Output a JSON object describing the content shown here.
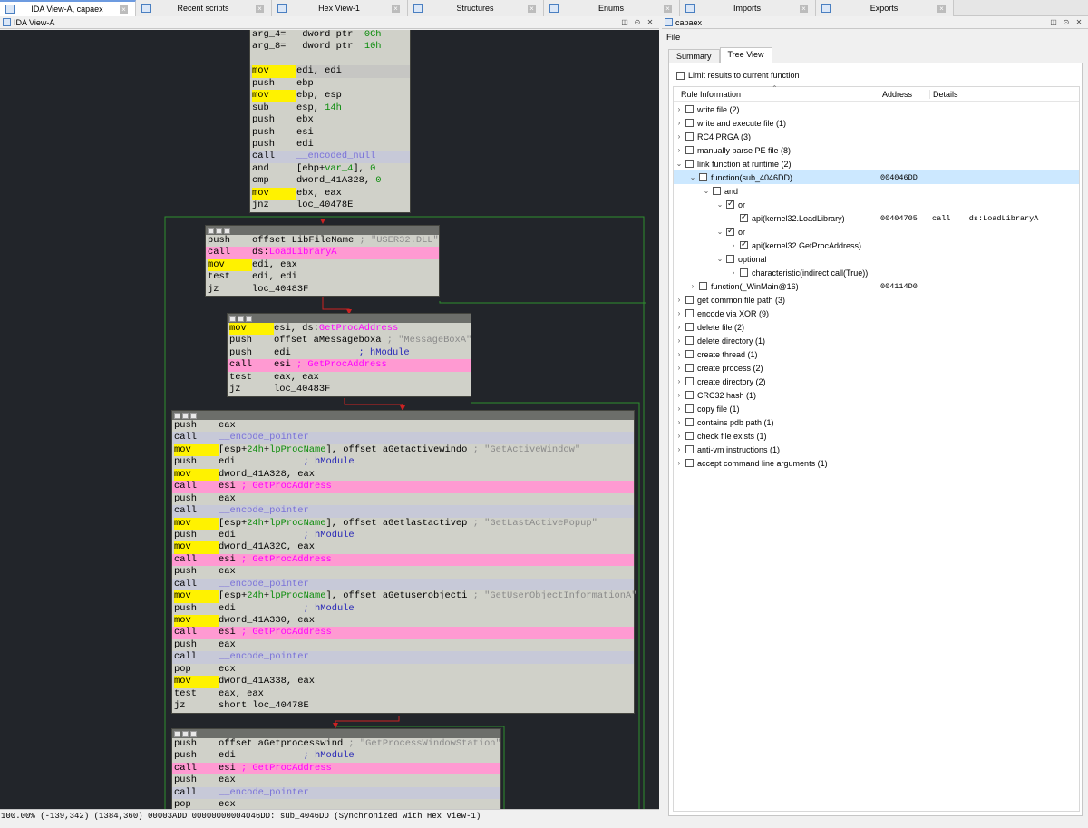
{
  "tabs": [
    {
      "label": "IDA View-A, capaex",
      "active": true
    },
    {
      "label": "Recent scripts"
    },
    {
      "label": "Hex View-1"
    },
    {
      "label": "Structures"
    },
    {
      "label": "Enums"
    },
    {
      "label": "Imports"
    },
    {
      "label": "Exports"
    }
  ],
  "ida": {
    "title": "IDA View-A",
    "status": "100.00% (-139,342) (1384,360) 00003ADD 00000000004046DD: sub_4046DD (Synchronized with Hex View-1)"
  },
  "capa": {
    "title": "capaex",
    "menu_file": "File",
    "tab_summary": "Summary",
    "tab_tree": "Tree View",
    "limit_label": "Limit results to current function",
    "col_rule": "Rule Information",
    "col_address": "Address",
    "col_details": "Details",
    "rows": [
      {
        "label": "write file (2)",
        "indent": 0,
        "arrow": "›",
        "cb": false
      },
      {
        "label": "write and execute file (1)",
        "indent": 0,
        "arrow": "›",
        "cb": false
      },
      {
        "label": "RC4 PRGA (3)",
        "indent": 0,
        "arrow": "›",
        "cb": false
      },
      {
        "label": "manually parse PE file (8)",
        "indent": 0,
        "arrow": "›",
        "cb": false
      },
      {
        "label": "link function at runtime (2)",
        "indent": 0,
        "arrow": "⌄",
        "cb": false
      },
      {
        "label": "function(sub_4046DD)",
        "indent": 1,
        "arrow": "⌄",
        "cb": false,
        "address": "004046DD",
        "selected": true
      },
      {
        "label": "and",
        "indent": 2,
        "arrow": "⌄",
        "cb": false
      },
      {
        "label": "or",
        "indent": 3,
        "arrow": "⌄",
        "cb": true
      },
      {
        "label": "api(kernel32.LoadLibrary)",
        "indent": 4,
        "arrow": "",
        "cb": true,
        "address": "00404705",
        "details": "call    ds:LoadLibraryA"
      },
      {
        "label": "or",
        "indent": 3,
        "arrow": "⌄",
        "cb": true
      },
      {
        "label": "api(kernel32.GetProcAddress)",
        "indent": 4,
        "arrow": "›",
        "cb": true
      },
      {
        "label": "optional",
        "indent": 3,
        "arrow": "⌄",
        "cb": false
      },
      {
        "label": "characteristic(indirect call(True))",
        "indent": 4,
        "arrow": "›",
        "cb": false
      },
      {
        "label": "function(_WinMain@16)",
        "indent": 1,
        "arrow": "›",
        "cb": false,
        "address": "004114D0"
      },
      {
        "label": "get common file path (3)",
        "indent": 0,
        "arrow": "›",
        "cb": false
      },
      {
        "label": "encode via XOR (9)",
        "indent": 0,
        "arrow": "›",
        "cb": false
      },
      {
        "label": "delete file (2)",
        "indent": 0,
        "arrow": "›",
        "cb": false
      },
      {
        "label": "delete directory (1)",
        "indent": 0,
        "arrow": "›",
        "cb": false
      },
      {
        "label": "create thread (1)",
        "indent": 0,
        "arrow": "›",
        "cb": false
      },
      {
        "label": "create process (2)",
        "indent": 0,
        "arrow": "›",
        "cb": false
      },
      {
        "label": "create directory (2)",
        "indent": 0,
        "arrow": "›",
        "cb": false
      },
      {
        "label": "CRC32 hash (1)",
        "indent": 0,
        "arrow": "›",
        "cb": false
      },
      {
        "label": "copy file (1)",
        "indent": 0,
        "arrow": "›",
        "cb": false
      },
      {
        "label": "contains pdb path (1)",
        "indent": 0,
        "arrow": "›",
        "cb": false
      },
      {
        "label": "check file exists (1)",
        "indent": 0,
        "arrow": "›",
        "cb": false
      },
      {
        "label": "anti-vm instructions (1)",
        "indent": 0,
        "arrow": "›",
        "cb": false
      },
      {
        "label": "accept command line arguments (1)",
        "indent": 0,
        "arrow": "›",
        "cb": false
      }
    ]
  },
  "graph": {
    "blocks": [
      {
        "header": false,
        "lines": [
          {
            "m": "arg_4=",
            "o": [
              [
                "",
                " dword ptr  "
              ],
              [
                "hx",
                "0Ch"
              ]
            ]
          },
          {
            "m": "arg_8=",
            "o": [
              [
                "",
                " dword ptr  "
              ],
              [
                "hx",
                "10h"
              ]
            ]
          },
          {
            "m": "",
            "o": []
          },
          {
            "m": "mov",
            "y": true,
            "hl": "line",
            "o": [
              [
                "",
                "edi, edi"
              ]
            ]
          },
          {
            "m": "push",
            "o": [
              [
                "",
                "ebp"
              ]
            ]
          },
          {
            "m": "mov",
            "y": true,
            "o": [
              [
                "",
                "ebp, esp"
              ]
            ]
          },
          {
            "m": "sub",
            "o": [
              [
                "",
                "esp, "
              ],
              [
                "hx",
                "14h"
              ]
            ]
          },
          {
            "m": "push",
            "o": [
              [
                "",
                "ebx"
              ]
            ]
          },
          {
            "m": "push",
            "o": [
              [
                "",
                "esi"
              ]
            ]
          },
          {
            "m": "push",
            "o": [
              [
                "",
                "edi"
              ]
            ]
          },
          {
            "m": "call",
            "hl": "grey",
            "o": [
              [
                "enc",
                "__encoded_null"
              ]
            ]
          },
          {
            "m": "and",
            "o": [
              [
                "",
                "[ebp+"
              ],
              [
                "lv",
                "var_4"
              ],
              [
                "",
                "], "
              ],
              [
                "hx",
                "0"
              ]
            ]
          },
          {
            "m": "cmp",
            "o": [
              [
                "",
                "dword_41A328, "
              ],
              [
                "hx",
                "0"
              ]
            ]
          },
          {
            "m": "mov",
            "y": true,
            "o": [
              [
                "",
                "ebx, eax"
              ]
            ]
          },
          {
            "m": "jnz",
            "o": [
              [
                "",
                "loc_40478E"
              ]
            ]
          }
        ]
      },
      {
        "header": true,
        "lines": [
          {
            "m": "push",
            "o": [
              [
                "",
                "offset LibFileName "
              ],
              [
                "cm",
                "; \"USER32.DLL\""
              ]
            ]
          },
          {
            "m": "call",
            "hl": "call",
            "o": [
              [
                "",
                "ds:"
              ],
              [
                "fn",
                "LoadLibraryA"
              ]
            ]
          },
          {
            "m": "mov",
            "y": true,
            "o": [
              [
                "",
                "edi, eax"
              ]
            ]
          },
          {
            "m": "test",
            "o": [
              [
                "",
                "edi, edi"
              ]
            ]
          },
          {
            "m": "jz",
            "o": [
              [
                "",
                "loc_40483F"
              ]
            ]
          }
        ]
      },
      {
        "header": true,
        "lines": [
          {
            "m": "mov",
            "y": true,
            "o": [
              [
                "",
                "esi, ds:"
              ],
              [
                "fn",
                "GetProcAddress"
              ]
            ]
          },
          {
            "m": "push",
            "o": [
              [
                "",
                "offset aMessageboxa "
              ],
              [
                "cm",
                "; \"MessageBoxA\""
              ]
            ]
          },
          {
            "m": "push",
            "o": [
              [
                "",
                "edi            "
              ],
              [
                "nm",
                "; hModule"
              ]
            ]
          },
          {
            "m": "call",
            "hl": "call",
            "o": [
              [
                "",
                "esi "
              ],
              [
                "fn",
                "; GetProcAddress"
              ]
            ]
          },
          {
            "m": "test",
            "o": [
              [
                "",
                "eax, eax"
              ]
            ]
          },
          {
            "m": "jz",
            "o": [
              [
                "",
                "loc_40483F"
              ]
            ]
          }
        ]
      },
      {
        "header": true,
        "lines": [
          {
            "m": "push",
            "o": [
              [
                "",
                "eax"
              ]
            ]
          },
          {
            "m": "call",
            "hl": "grey",
            "o": [
              [
                "enc",
                "__encode_pointer"
              ]
            ]
          },
          {
            "m": "mov",
            "y": true,
            "o": [
              [
                "",
                "[esp+"
              ],
              [
                "hx",
                "24h"
              ],
              [
                "",
                "+"
              ],
              [
                "lv",
                "lpProcName"
              ],
              [
                "",
                "], offset aGetactivewindo "
              ],
              [
                "cm",
                "; \"GetActiveWindow\""
              ]
            ]
          },
          {
            "m": "push",
            "o": [
              [
                "",
                "edi            "
              ],
              [
                "nm",
                "; hModule"
              ]
            ]
          },
          {
            "m": "mov",
            "y": true,
            "o": [
              [
                "",
                "dword_41A328, eax"
              ]
            ]
          },
          {
            "m": "call",
            "hl": "call",
            "o": [
              [
                "",
                "esi "
              ],
              [
                "fn",
                "; GetProcAddress"
              ]
            ]
          },
          {
            "m": "push",
            "o": [
              [
                "",
                "eax"
              ]
            ]
          },
          {
            "m": "call",
            "hl": "grey",
            "o": [
              [
                "enc",
                "__encode_pointer"
              ]
            ]
          },
          {
            "m": "mov",
            "y": true,
            "o": [
              [
                "",
                "[esp+"
              ],
              [
                "hx",
                "24h"
              ],
              [
                "",
                "+"
              ],
              [
                "lv",
                "lpProcName"
              ],
              [
                "",
                "], offset aGetlastactivep "
              ],
              [
                "cm",
                "; \"GetLastActivePopup\""
              ]
            ]
          },
          {
            "m": "push",
            "o": [
              [
                "",
                "edi            "
              ],
              [
                "nm",
                "; hModule"
              ]
            ]
          },
          {
            "m": "mov",
            "y": true,
            "o": [
              [
                "",
                "dword_41A32C, eax"
              ]
            ]
          },
          {
            "m": "call",
            "hl": "call",
            "o": [
              [
                "",
                "esi "
              ],
              [
                "fn",
                "; GetProcAddress"
              ]
            ]
          },
          {
            "m": "push",
            "o": [
              [
                "",
                "eax"
              ]
            ]
          },
          {
            "m": "call",
            "hl": "grey",
            "o": [
              [
                "enc",
                "__encode_pointer"
              ]
            ]
          },
          {
            "m": "mov",
            "y": true,
            "o": [
              [
                "",
                "[esp+"
              ],
              [
                "hx",
                "24h"
              ],
              [
                "",
                "+"
              ],
              [
                "lv",
                "lpProcName"
              ],
              [
                "",
                "], offset aGetuserobjecti "
              ],
              [
                "cm",
                "; \"GetUserObjectInformationA\""
              ]
            ]
          },
          {
            "m": "push",
            "o": [
              [
                "",
                "edi            "
              ],
              [
                "nm",
                "; hModule"
              ]
            ]
          },
          {
            "m": "mov",
            "y": true,
            "o": [
              [
                "",
                "dword_41A330, eax"
              ]
            ]
          },
          {
            "m": "call",
            "hl": "call",
            "o": [
              [
                "",
                "esi "
              ],
              [
                "fn",
                "; GetProcAddress"
              ]
            ]
          },
          {
            "m": "push",
            "o": [
              [
                "",
                "eax"
              ]
            ]
          },
          {
            "m": "call",
            "hl": "grey",
            "o": [
              [
                "enc",
                "__encode_pointer"
              ]
            ]
          },
          {
            "m": "pop",
            "o": [
              [
                "",
                "ecx"
              ]
            ]
          },
          {
            "m": "mov",
            "y": true,
            "o": [
              [
                "",
                "dword_41A338, eax"
              ]
            ]
          },
          {
            "m": "test",
            "o": [
              [
                "",
                "eax, eax"
              ]
            ]
          },
          {
            "m": "jz",
            "o": [
              [
                "",
                "short loc_40478E"
              ]
            ]
          }
        ]
      },
      {
        "header": true,
        "lines": [
          {
            "m": "push",
            "o": [
              [
                "",
                "offset aGetprocesswind "
              ],
              [
                "cm",
                "; \"GetProcessWindowStation\""
              ]
            ]
          },
          {
            "m": "push",
            "o": [
              [
                "",
                "edi            "
              ],
              [
                "nm",
                "; hModule"
              ]
            ]
          },
          {
            "m": "call",
            "hl": "call",
            "o": [
              [
                "",
                "esi "
              ],
              [
                "fn",
                "; GetProcAddress"
              ]
            ]
          },
          {
            "m": "push",
            "o": [
              [
                "",
                "eax"
              ]
            ]
          },
          {
            "m": "call",
            "hl": "grey",
            "o": [
              [
                "enc",
                "__encode_pointer"
              ]
            ]
          },
          {
            "m": "pop",
            "o": [
              [
                "",
                "ecx"
              ]
            ]
          }
        ]
      }
    ]
  }
}
